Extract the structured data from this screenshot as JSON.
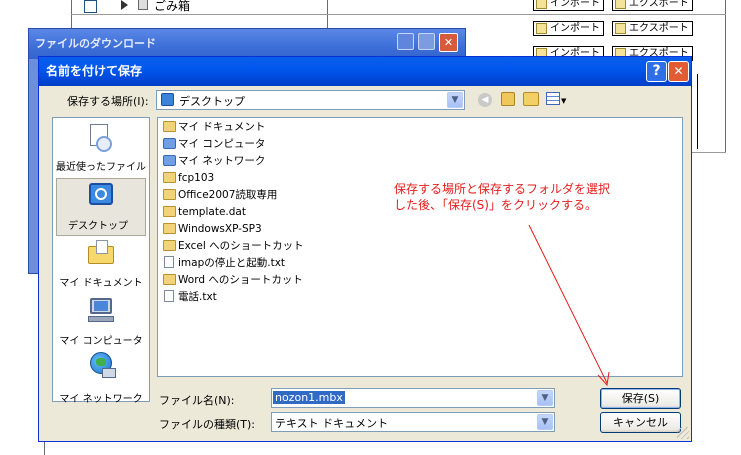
{
  "background": {
    "rows": [
      {
        "label": "ごみ箱",
        "import": "インポート",
        "export": "エクスポート"
      },
      {
        "label": "",
        "import": "インポート",
        "export": "エクスポート"
      },
      {
        "label": "",
        "import": "インポート",
        "export": "エクスポート"
      }
    ]
  },
  "outer_window": {
    "title": "ファイルのダウンロード"
  },
  "dialog": {
    "title": "名前を付けて保存",
    "help": "?",
    "close": "✕",
    "location_label": "保存する場所(I):",
    "location_value": "デスクトップ",
    "places": [
      {
        "label": "最近使ったファイル",
        "icon": "recent-documents-icon"
      },
      {
        "label": "デスクトップ",
        "icon": "desktop-icon"
      },
      {
        "label": "マイ ドキュメント",
        "icon": "my-documents-icon"
      },
      {
        "label": "マイ コンピュータ",
        "icon": "my-computer-icon"
      },
      {
        "label": "マイ ネットワーク",
        "icon": "my-network-icon"
      }
    ],
    "files": [
      {
        "name": "マイ ドキュメント",
        "icon": "folder"
      },
      {
        "name": "マイ コンピュータ",
        "icon": "sys"
      },
      {
        "name": "マイ ネットワーク",
        "icon": "sys"
      },
      {
        "name": "fcp103",
        "icon": "folder"
      },
      {
        "name": "Office2007読取専用",
        "icon": "folder"
      },
      {
        "name": "template.dat",
        "icon": "folder"
      },
      {
        "name": "WindowsXP-SP3",
        "icon": "folder"
      },
      {
        "name": "Excel へのショートカット",
        "icon": "folder"
      },
      {
        "name": "imapの停止と起動.txt",
        "icon": "doc"
      },
      {
        "name": "Word へのショートカット",
        "icon": "folder"
      },
      {
        "name": "電話.txt",
        "icon": "doc"
      }
    ],
    "annotation_line1": "保存する場所と保存するフォルダを選択",
    "annotation_line2": "した後、「保存(S)」をクリックする。",
    "filename_label": "ファイル名(N):",
    "filename_value": "nozon1.mbx",
    "filetype_label": "ファイルの種類(T):",
    "filetype_value": "テキスト ドキュメント",
    "save_button": "保存(S)",
    "cancel_button": "キャンセル"
  },
  "colors": {
    "annotation": "#e51c1c",
    "titlebar": "#0058ee"
  }
}
